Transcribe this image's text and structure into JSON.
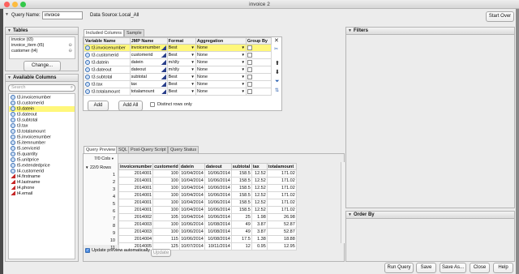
{
  "window": {
    "title": "invoice 2"
  },
  "query": {
    "name_label": "Query Name:",
    "name_value": "invoice",
    "datasource_label": "Data Source:",
    "datasource_value": "Local_All",
    "start_over": "Start Over"
  },
  "tables": {
    "title": "Tables",
    "items": [
      {
        "label": "invoice (t3)"
      },
      {
        "label": "invoice_item (t5)"
      },
      {
        "label": "customer (t4)"
      }
    ],
    "change_button": "Change..."
  },
  "available": {
    "title": "Available Columns",
    "search_placeholder": "Search",
    "items": [
      {
        "label": "t3.invoicenumber",
        "type": "numeric",
        "selected": false
      },
      {
        "label": "t3.customerid",
        "type": "numeric",
        "selected": false
      },
      {
        "label": "t3.datein",
        "type": "numeric",
        "selected": true
      },
      {
        "label": "t3.dateout",
        "type": "numeric",
        "selected": false
      },
      {
        "label": "t3.subtotal",
        "type": "numeric",
        "selected": false
      },
      {
        "label": "t3.tax",
        "type": "numeric",
        "selected": false
      },
      {
        "label": "t3.totalamount",
        "type": "numeric",
        "selected": false
      },
      {
        "label": "t5.invoicenumber",
        "type": "numeric",
        "selected": false
      },
      {
        "label": "t5.itemnumber",
        "type": "numeric",
        "selected": false
      },
      {
        "label": "t5.serviceid",
        "type": "numeric",
        "selected": false
      },
      {
        "label": "t5.quantity",
        "type": "numeric",
        "selected": false
      },
      {
        "label": "t5.unitprice",
        "type": "numeric",
        "selected": false
      },
      {
        "label": "t5.extendedprice",
        "type": "numeric",
        "selected": false
      },
      {
        "label": "t4.customerid",
        "type": "numeric",
        "selected": false
      },
      {
        "label": "t4.firstname",
        "type": "text",
        "selected": false
      },
      {
        "label": "t4.lastname",
        "type": "text",
        "selected": false
      },
      {
        "label": "t4.phone",
        "type": "text",
        "selected": false
      },
      {
        "label": "t4.email",
        "type": "text",
        "selected": false
      }
    ]
  },
  "included": {
    "tabs": [
      {
        "label": "Included Columns"
      },
      {
        "label": "Sample"
      }
    ],
    "headers": [
      "Variable Name",
      "JMP Name",
      "Format",
      "Aggregation",
      "Group By"
    ],
    "rows": [
      {
        "variable": "t3.invoicenumber",
        "jmp": "invoicenumber",
        "format": "Best",
        "aggregation": "None",
        "highlight": true
      },
      {
        "variable": "t3.customerid",
        "jmp": "customerid",
        "format": "Best",
        "aggregation": "None",
        "highlight": false
      },
      {
        "variable": "t3.datein",
        "jmp": "datein",
        "format": "m/d/y",
        "aggregation": "None",
        "highlight": false
      },
      {
        "variable": "t3.dateout",
        "jmp": "dateout",
        "format": "m/d/y",
        "aggregation": "None",
        "highlight": false
      },
      {
        "variable": "t3.subtotal",
        "jmp": "subtotal",
        "format": "Best",
        "aggregation": "None",
        "highlight": false
      },
      {
        "variable": "t3.tax",
        "jmp": "tax",
        "format": "Best",
        "aggregation": "None",
        "highlight": false
      },
      {
        "variable": "t3.totalamount",
        "jmp": "totalamount",
        "format": "Best",
        "aggregation": "None",
        "highlight": false
      }
    ],
    "add_button": "Add",
    "add_all_button": "Add All",
    "distinct_label": "Distinct rows only"
  },
  "filters": {
    "title": "Filters"
  },
  "order_by": {
    "title": "Order By"
  },
  "preview": {
    "tabs": [
      {
        "label": "Query Preview"
      },
      {
        "label": "SQL"
      },
      {
        "label": "Post-Query Script"
      },
      {
        "label": "Query Status"
      }
    ],
    "cols_label": "7/0 Cols",
    "rows_label": "22/0 Rows",
    "headers": [
      "invoicenumber",
      "customerid",
      "datein",
      "dateout",
      "subtotal",
      "tax",
      "totalamount"
    ],
    "rows": [
      {
        "n": "1",
        "cells": [
          "2014001",
          "100",
          "10/04/2014",
          "10/06/2014",
          "158.5",
          "12.52",
          "171.02"
        ]
      },
      {
        "n": "2",
        "cells": [
          "2014001",
          "100",
          "10/04/2014",
          "10/06/2014",
          "158.5",
          "12.52",
          "171.02"
        ]
      },
      {
        "n": "3",
        "cells": [
          "2014001",
          "100",
          "10/04/2014",
          "10/06/2014",
          "158.5",
          "12.52",
          "171.02"
        ]
      },
      {
        "n": "4",
        "cells": [
          "2014001",
          "100",
          "10/04/2014",
          "10/06/2014",
          "158.5",
          "12.52",
          "171.02"
        ]
      },
      {
        "n": "5",
        "cells": [
          "2014001",
          "100",
          "10/04/2014",
          "10/06/2014",
          "158.5",
          "12.52",
          "171.02"
        ]
      },
      {
        "n": "6",
        "cells": [
          "2014001",
          "100",
          "10/04/2014",
          "10/06/2014",
          "158.5",
          "12.52",
          "171.02"
        ]
      },
      {
        "n": "7",
        "cells": [
          "2014002",
          "105",
          "10/04/2014",
          "10/06/2014",
          "25",
          "1.98",
          "26.98"
        ]
      },
      {
        "n": "8",
        "cells": [
          "2014003",
          "100",
          "10/06/2014",
          "10/08/2014",
          "49",
          "3.87",
          "52.87"
        ]
      },
      {
        "n": "9",
        "cells": [
          "2014003",
          "100",
          "10/06/2014",
          "10/08/2014",
          "49",
          "3.87",
          "52.87"
        ]
      },
      {
        "n": "10",
        "cells": [
          "2014004",
          "115",
          "10/06/2014",
          "10/08/2014",
          "17.5",
          "1.38",
          "18.88"
        ]
      },
      {
        "n": "11",
        "cells": [
          "2014005",
          "125",
          "10/07/2014",
          "10/11/2014",
          "12",
          "0.95",
          "12.95"
        ]
      }
    ],
    "update_auto_label": "Update preview automatically",
    "update_button": "Update"
  },
  "footer": {
    "run_query": "Run Query",
    "save": "Save",
    "save_as": "Save As...",
    "close": "Close",
    "help": "Help"
  }
}
